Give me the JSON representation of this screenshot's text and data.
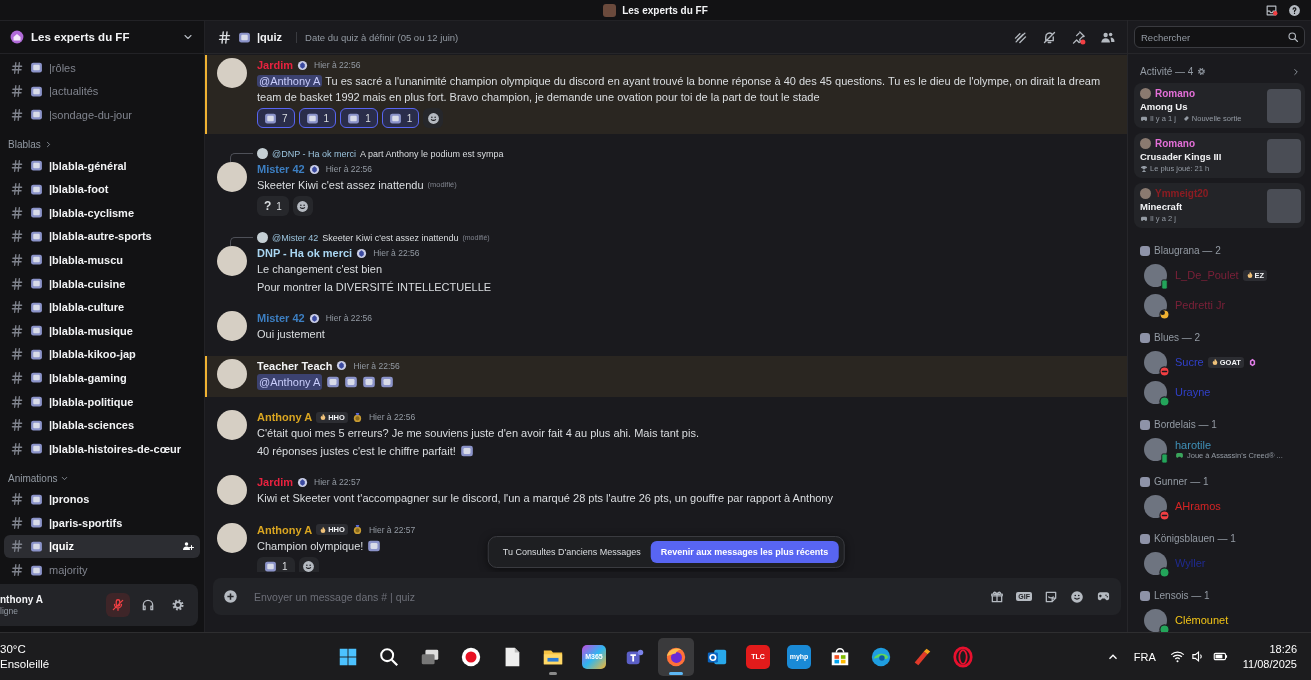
{
  "title_bar": {
    "title": "Les experts du FF"
  },
  "server": {
    "name": "Les experts du FF"
  },
  "channel_sections": [
    {
      "channels": [
        {
          "name": "|rôles",
          "unread": false,
          "selected": false
        },
        {
          "name": "|actualités",
          "unread": false,
          "selected": false
        },
        {
          "name": "|sondage-du-jour",
          "unread": false,
          "selected": false
        }
      ]
    },
    {
      "category": "Blablas",
      "expanded": false,
      "channels": [
        {
          "name": "|blabla-général",
          "unread": true,
          "selected": false
        },
        {
          "name": "|blabla-foot",
          "unread": true,
          "selected": false
        },
        {
          "name": "|blabla-cyclisme",
          "unread": true,
          "selected": false
        },
        {
          "name": "|blabla-autre-sports",
          "unread": true,
          "selected": false
        },
        {
          "name": "|blabla-muscu",
          "unread": true,
          "selected": false
        },
        {
          "name": "|blabla-cuisine",
          "unread": true,
          "selected": false
        },
        {
          "name": "|blabla-culture",
          "unread": true,
          "selected": false
        },
        {
          "name": "|blabla-musique",
          "unread": true,
          "selected": false
        },
        {
          "name": "|blabla-kikoo-jap",
          "unread": true,
          "selected": false
        },
        {
          "name": "|blabla-gaming",
          "unread": true,
          "selected": false
        },
        {
          "name": "|blabla-politique",
          "unread": true,
          "selected": false
        },
        {
          "name": "|blabla-sciences",
          "unread": true,
          "selected": false
        },
        {
          "name": "|blabla-histoires-de-cœur",
          "unread": true,
          "selected": false
        }
      ]
    },
    {
      "category": "Animations",
      "expanded": true,
      "channels": [
        {
          "name": "|pronos",
          "unread": true,
          "selected": false
        },
        {
          "name": "|paris-sportifs",
          "unread": true,
          "selected": false
        },
        {
          "name": "|quiz",
          "unread": true,
          "selected": true
        },
        {
          "name": "majority",
          "unread": false,
          "selected": false
        }
      ]
    }
  ],
  "user_panel": {
    "name": "nthony A",
    "status": "ligne",
    "mic_muted": true
  },
  "chat_header": {
    "channel": "|quiz",
    "topic": "Date du quiz à définir (05 ou 12 juin)"
  },
  "messages": [
    {
      "author": "Jardim",
      "color": "#e8223f",
      "time": "Hier à 22:56",
      "highlighted": true,
      "lines": [
        {
          "mention": "@Anthony A",
          "text": "Tu es sacré a l'unanimité champion olympique du discord en ayant trouvé la bonne réponse à 40 des 45 questions. Tu es le dieu de l'olympe, on dirait la dream team de basket 1992 mais en plus fort. Bravo champion, je demande une ovation pour toi de la part de tout le stade"
        }
      ],
      "reactions": [
        {
          "count": "7",
          "selected": true
        },
        {
          "count": "1",
          "selected": true
        },
        {
          "count": "1",
          "selected": true
        },
        {
          "count": "1",
          "selected": true
        }
      ]
    },
    {
      "author": "Mister 42",
      "color": "#3d7fc2",
      "time": "Hier à 22:56",
      "highlighted": false,
      "reply": {
        "author": "@DNP - Ha ok merci",
        "text": "A part Anthony le podium est sympa"
      },
      "lines": [
        {
          "text": "Skeeter Kiwi c'est assez  inattendu",
          "edited": "(modifié)"
        }
      ],
      "reactions": [
        {
          "glyph": "?",
          "count": "1",
          "selected": false
        }
      ]
    },
    {
      "author": "DNP - Ha ok merci",
      "color": "#a9d6f2",
      "time": "Hier à 22:56",
      "highlighted": false,
      "reply": {
        "author": "@Mister 42",
        "text": "Skeeter Kiwi c'est assez  inattendu",
        "edited": "(modifié)"
      },
      "lines": [
        {
          "text": "Le changement c'est bien"
        },
        {
          "text": "Pour montrer la DIVERSITÉ INTELLECTUELLE"
        }
      ]
    },
    {
      "author": "Mister 42",
      "color": "#3d7fc2",
      "time": "Hier à 22:56",
      "highlighted": false,
      "lines": [
        {
          "text": "Oui justement"
        }
      ]
    },
    {
      "author": "Teacher Teach",
      "color": "#f2f3f5",
      "time": "Hier à 22:56",
      "highlighted": true,
      "lines": [
        {
          "mention": "@Anthony A",
          "emojis": [
            {
              "kind": "custom"
            },
            {
              "kind": "custom"
            },
            {
              "kind": "custom"
            },
            {
              "kind": "custom"
            }
          ]
        }
      ]
    },
    {
      "author": "Anthony A",
      "color": "#d9a521",
      "tag": "HHO",
      "time": "Hier à 22:56",
      "highlighted": false,
      "lines": [
        {
          "text": "C'était quoi mes 5 erreurs? Je me souviens juste d'en avoir fait 4 au plus ahi. Mais tant pis."
        },
        {
          "text": "40 réponses justes c'est le chiffre parfait!",
          "emojis": [
            {
              "kind": "custom"
            }
          ]
        }
      ]
    },
    {
      "author": "Jardim",
      "color": "#e8223f",
      "time": "Hier à 22:57",
      "highlighted": false,
      "lines": [
        {
          "text": "Kiwi et Skeeter vont t'accompagner sur le discord, l'un a marqué 28 pts l'autre 26 pts, un gouffre par rapport à Anthony"
        }
      ]
    },
    {
      "author": "Anthony A",
      "color": "#d9a521",
      "tag": "HHO",
      "time": "Hier à 22:57",
      "highlighted": false,
      "lines": [
        {
          "text": "Champion olympique!",
          "emojis": [
            {
              "kind": "custom"
            }
          ]
        }
      ],
      "reactions": [
        {
          "count": "1",
          "selected": false
        }
      ]
    }
  ],
  "jump_bar": {
    "notice": "Tu Consultes D'anciens Messages",
    "button": "Revenir aux messages les plus récents"
  },
  "composer": {
    "placeholder": "Envoyer un message dans # | quiz",
    "gif_label": "GIF"
  },
  "member_search": {
    "placeholder": "Rechercher"
  },
  "activity": {
    "title": "Activité — 4",
    "cards": [
      {
        "user": "Romano",
        "color": "#e36fd8",
        "game": "Among Us",
        "meta": [
          {
            "kind": "controller",
            "text": "Il y a 1 j"
          },
          {
            "kind": "rocket",
            "text": "Nouvelle sortie"
          }
        ]
      },
      {
        "user": "Romano",
        "color": "#e36fd8",
        "game": "Crusader Kings III",
        "meta": [
          {
            "kind": "trophy",
            "text": "Le plus joué: 21 h"
          }
        ]
      },
      {
        "user": "Ymmeigt20",
        "color": "#8c1c22",
        "game": "Minecraft",
        "meta": [
          {
            "kind": "controller",
            "text": "Il y a 2 j"
          }
        ]
      }
    ]
  },
  "member_groups": [
    {
      "name": "Blaugrana — 2",
      "members": [
        {
          "name": "L_De_Poulet",
          "color": "#7a2038",
          "presence": {
            "kind": "mobile"
          },
          "tag": "EZ",
          "boosting": false
        },
        {
          "name": "Pedretti Jr",
          "color": "#7a2038",
          "presence": {
            "kind": "idle"
          },
          "boosting": false
        }
      ]
    },
    {
      "name": "Blues — 2",
      "members": [
        {
          "name": "Sucre",
          "color": "#3040c8",
          "presence": {
            "kind": "dnd"
          },
          "tag": "GOAT",
          "boosting": true
        },
        {
          "name": "Urayne",
          "color": "#3040c8",
          "presence": {
            "kind": "online"
          },
          "boosting": false
        }
      ]
    },
    {
      "name": "Bordelais — 1",
      "members": [
        {
          "name": "harotile",
          "color": "#3f90b8",
          "presence": {
            "kind": "mobile"
          },
          "activity": "Joue à Assassin's Creed® ...",
          "boosting": false
        }
      ]
    },
    {
      "name": "Gunner — 1",
      "members": [
        {
          "name": "AHramos",
          "color": "#d42424",
          "presence": {
            "kind": "dnd"
          },
          "boosting": false
        }
      ]
    },
    {
      "name": "Königsblauen — 1",
      "members": [
        {
          "name": "Wyller",
          "color": "#1f2a90",
          "presence": {
            "kind": "online"
          },
          "boosting": false
        }
      ]
    },
    {
      "name": "Lensois — 1",
      "members": [
        {
          "name": "Clémounet",
          "color": "#f2c416",
          "presence": {
            "kind": "online"
          },
          "boosting": false
        }
      ]
    }
  ],
  "taskbar": {
    "weather": {
      "temp": "30°C",
      "condition": "Ensoleillé"
    },
    "apps": [
      {
        "kind": "start",
        "running": false,
        "selected": false
      },
      {
        "kind": "search",
        "running": false,
        "selected": false
      },
      {
        "kind": "taskview",
        "running": false,
        "selected": false
      },
      {
        "kind": "record",
        "running": false,
        "selected": false
      },
      {
        "kind": "file",
        "running": false,
        "selected": false
      },
      {
        "kind": "folder",
        "running": true,
        "selected": false
      },
      {
        "kind": "m365",
        "label": "M365",
        "running": false,
        "selected": false
      },
      {
        "kind": "teams",
        "running": false,
        "selected": false
      },
      {
        "kind": "firefox",
        "running": true,
        "selected": true
      },
      {
        "kind": "outlook",
        "running": false,
        "selected": false
      },
      {
        "kind": "tlc",
        "label": "TLC",
        "running": false,
        "selected": false
      },
      {
        "kind": "myhp",
        "label": "myhp",
        "running": false,
        "selected": false
      },
      {
        "kind": "store",
        "running": false,
        "selected": false
      },
      {
        "kind": "edge",
        "running": false,
        "selected": false
      },
      {
        "kind": "ccleaner",
        "running": false,
        "selected": false
      },
      {
        "kind": "opera",
        "running": false,
        "selected": false
      }
    ],
    "language": "FRA",
    "time": "18:26",
    "date": "11/08/2025"
  }
}
